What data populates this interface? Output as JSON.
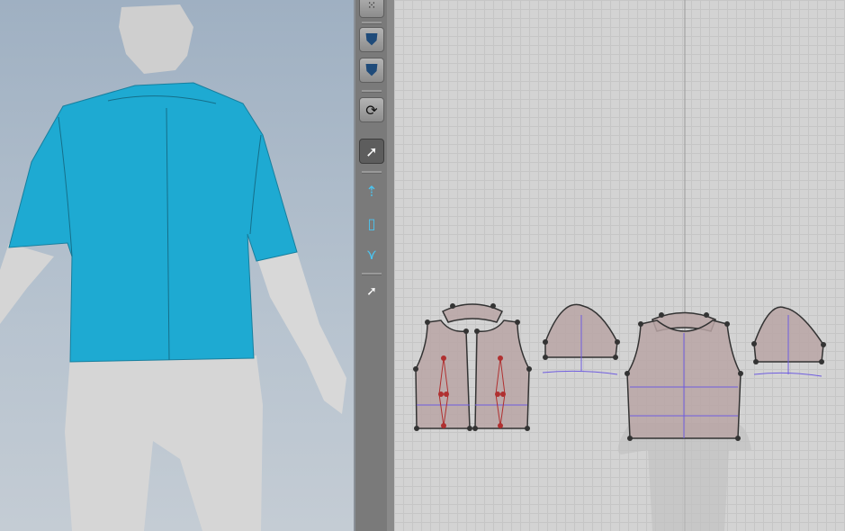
{
  "app": {
    "view_3d": "3d-garment-window",
    "view_2d": "2d-pattern-window"
  },
  "toolbar": {
    "tools": [
      {
        "icon": "arrange-points-icon"
      },
      {
        "icon": "garment-front-icon"
      },
      {
        "icon": "garment-avatar-icon"
      },
      {
        "icon": "simulate-refresh-icon"
      },
      {
        "icon": "transform-pattern-icon",
        "active": true
      },
      {
        "icon": "edit-point-line-icon"
      },
      {
        "icon": "segment-sewing-icon"
      },
      {
        "icon": "free-sewing-icon"
      },
      {
        "icon": "texture-edit-icon"
      }
    ]
  },
  "colors": {
    "garment": "#1eaad2",
    "pattern_fill": "#b9a5a5",
    "pattern_stroke": "#333333",
    "internal_line": "#6f5de0",
    "dart": "#b03030",
    "avatar": "#d8d8d8"
  }
}
